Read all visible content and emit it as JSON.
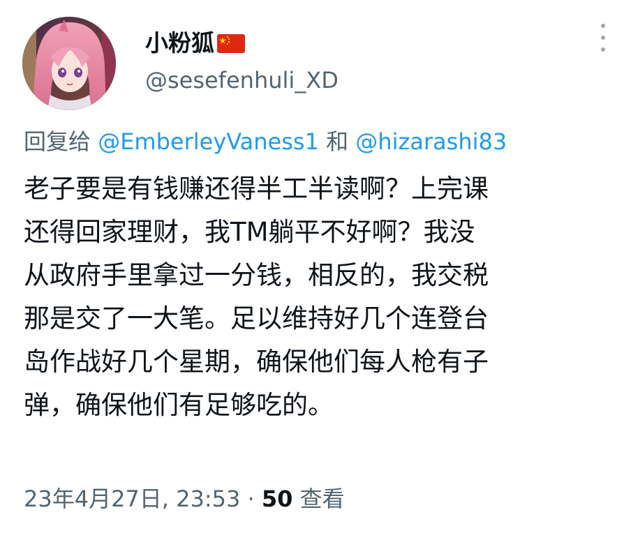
{
  "author": {
    "display_name": "小粉狐",
    "flag_icon": "china-flag-icon",
    "handle": "@sesefenhuli_XD"
  },
  "reply": {
    "prefix": "回复给",
    "mention_1": "@EmberleyVaness1",
    "joiner": "和",
    "mention_2": "@hizarashi83"
  },
  "tweet": {
    "lines": [
      "老子要是有钱赚还得半工半读啊？上完课",
      "还得回家理财，我TM躺平不好啊？我没",
      "从政府手里拿过一分钱，相反的，我交税",
      "那是交了一大笔。足以维持好几个连登台",
      "岛作战好几个星期，确保他们每人枪有子",
      "弹，确保他们有足够吃的。"
    ]
  },
  "meta": {
    "timestamp": "23年4月27日, 23:53",
    "separator": "·",
    "views_count": "50",
    "views_label": "查看"
  },
  "colors": {
    "mention": "#1d9bf0",
    "secondary_text": "#536471",
    "primary_text": "#0f1419"
  }
}
